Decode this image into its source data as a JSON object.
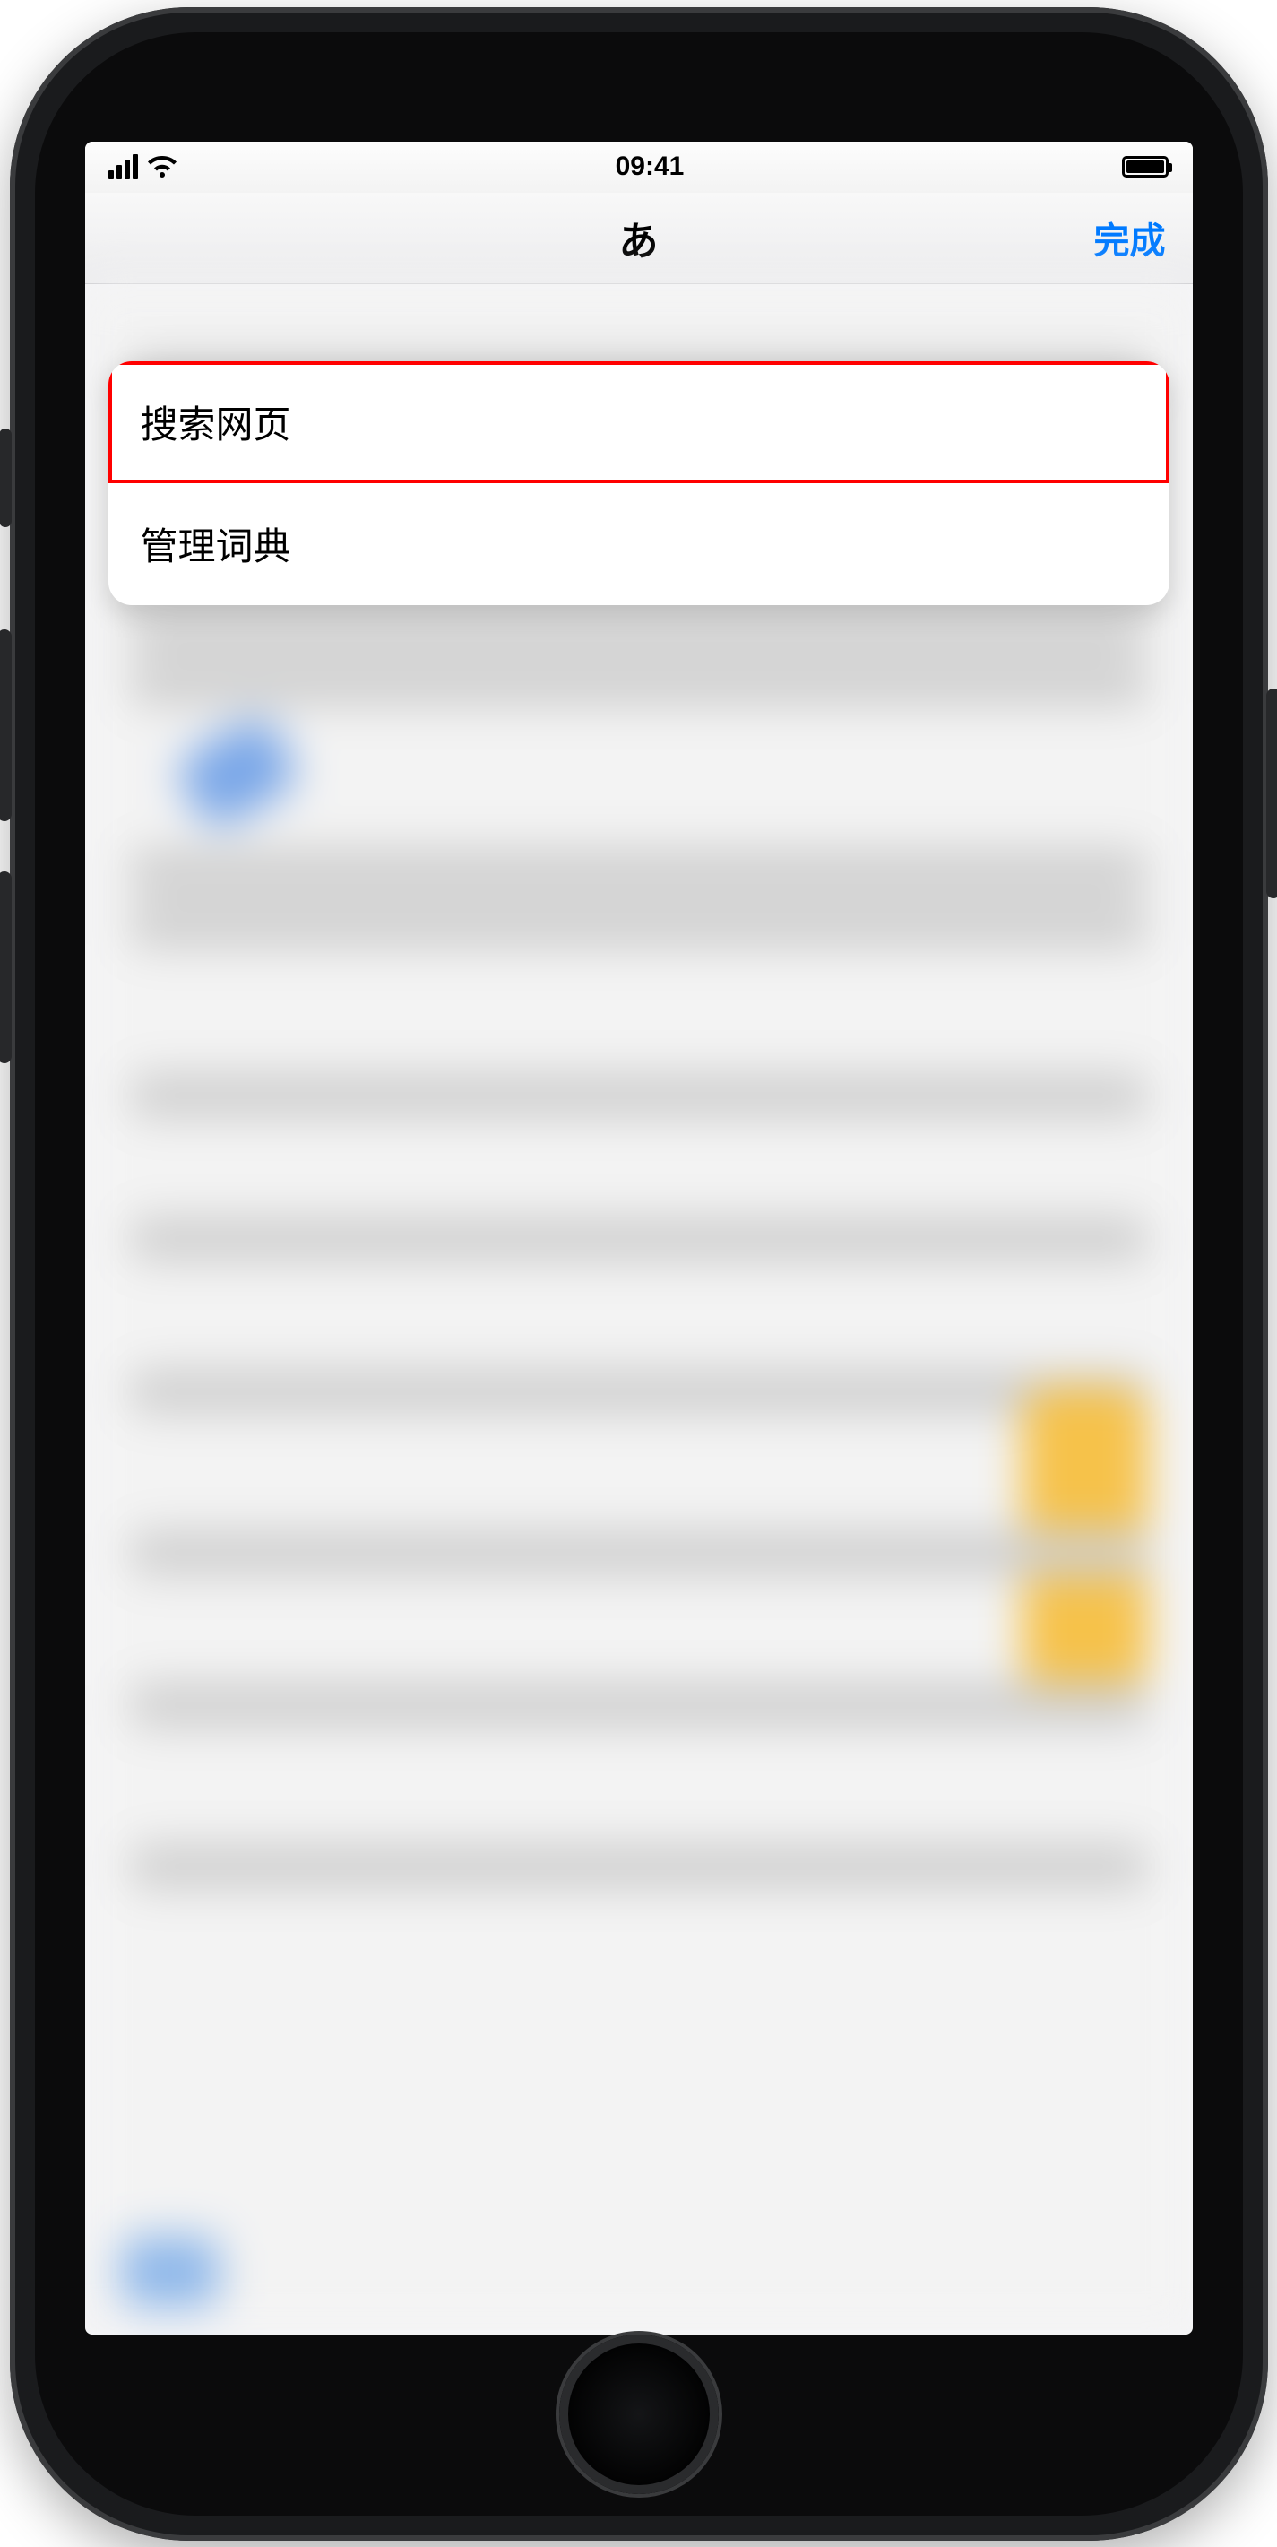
{
  "statusbar": {
    "time": "09:41"
  },
  "navbar": {
    "title": "あ",
    "done_label": "完成"
  },
  "menu": {
    "items": [
      {
        "label": "搜索网页",
        "highlighted": true
      },
      {
        "label": "管理词典",
        "highlighted": false
      }
    ]
  }
}
